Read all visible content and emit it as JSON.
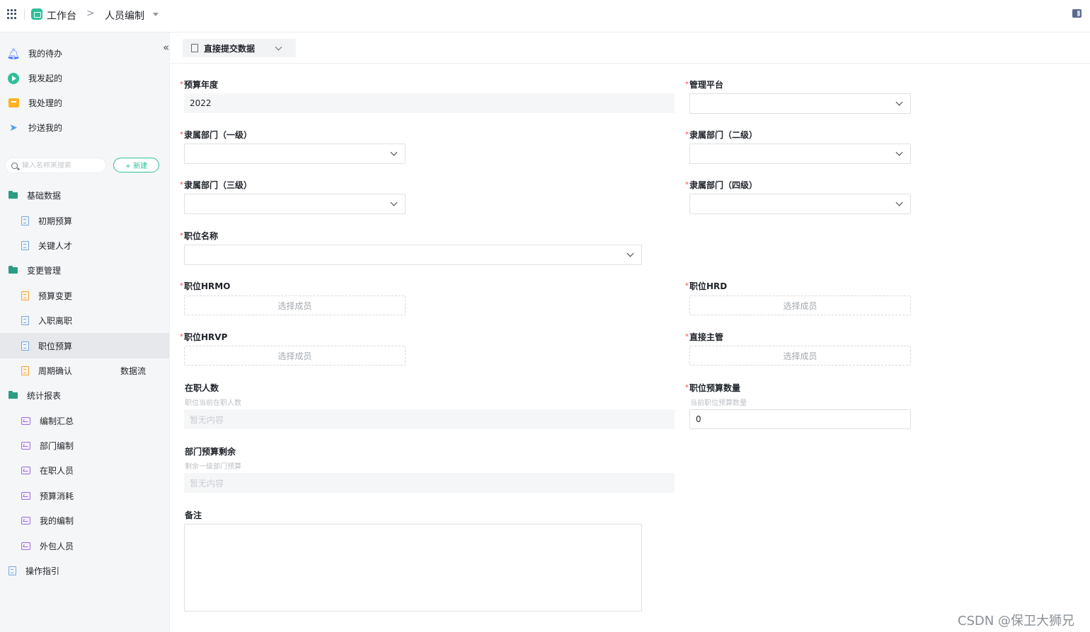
{
  "header": {
    "workspace": "工作台",
    "breadcrumb_sep": ">",
    "app_name": "人员编制"
  },
  "sidebar": {
    "quick": [
      {
        "label": "我的待办",
        "icon": "bell-icon"
      },
      {
        "label": "我发起的",
        "icon": "play-circle-icon"
      },
      {
        "label": "我处理的",
        "icon": "inbox-icon"
      },
      {
        "label": "抄送我的",
        "icon": "send-icon"
      }
    ],
    "search_placeholder": "输入名称来搜索",
    "new_label": "+ 新建",
    "tree": [
      {
        "type": "group",
        "label": "基础数据",
        "icon": "folder-icon"
      },
      {
        "type": "leaf",
        "label": "初期预算",
        "icon": "form-icon"
      },
      {
        "type": "leaf",
        "label": "关键人才",
        "icon": "form-icon"
      },
      {
        "type": "group",
        "label": "变更管理",
        "icon": "folder-icon"
      },
      {
        "type": "leaf",
        "label": "预算变更",
        "icon": "flow-form-icon"
      },
      {
        "type": "leaf",
        "label": "入职离职",
        "icon": "form-icon"
      },
      {
        "type": "leaf",
        "label": "职位预算",
        "icon": "form-icon",
        "active": true
      },
      {
        "type": "leaf",
        "label": "周期确认",
        "icon": "flow-form-icon",
        "extra": "数据流"
      },
      {
        "type": "group",
        "label": "统计报表",
        "icon": "folder-icon"
      },
      {
        "type": "leaf",
        "label": "编制汇总",
        "icon": "report-icon"
      },
      {
        "type": "leaf",
        "label": "部门编制",
        "icon": "report-icon"
      },
      {
        "type": "leaf",
        "label": "在职人员",
        "icon": "report-icon"
      },
      {
        "type": "leaf",
        "label": "预算消耗",
        "icon": "report-icon"
      },
      {
        "type": "leaf",
        "label": "我的编制",
        "icon": "report-icon"
      },
      {
        "type": "leaf",
        "label": "外包人员",
        "icon": "report-icon"
      },
      {
        "type": "rootleaf",
        "label": "操作指引",
        "icon": "form-icon"
      }
    ]
  },
  "toolbar": {
    "submit_label": "直接提交数据"
  },
  "form": {
    "required_mark": "*",
    "budget_year": {
      "label": "预算年度",
      "value": "2022"
    },
    "platform": {
      "label": "管理平台"
    },
    "dept1": {
      "label": "隶属部门（一级）"
    },
    "dept2": {
      "label": "隶属部门（二级）"
    },
    "dept3": {
      "label": "隶属部门（三级）"
    },
    "dept4": {
      "label": "隶属部门（四级）"
    },
    "position_name": {
      "label": "职位名称"
    },
    "hrmo": {
      "label": "职位HRMO",
      "placeholder": "选择成员"
    },
    "hrd": {
      "label": "职位HRD",
      "placeholder": "选择成员"
    },
    "hrvp": {
      "label": "职位HRVP",
      "placeholder": "选择成员"
    },
    "manager": {
      "label": "直接主管",
      "placeholder": "选择成员"
    },
    "headcount": {
      "label": "在职人数",
      "hint": "职位当前在职人数",
      "value": "暂无内容"
    },
    "budget_count": {
      "label": "职位预算数量",
      "hint": "当前职位预算数量",
      "value": "0"
    },
    "dept_remaining": {
      "label": "部门预算剩余",
      "hint": "剩余一级部门预算",
      "value": "暂无内容"
    },
    "remark": {
      "label": "备注"
    }
  },
  "watermark": "CSDN @保卫大狮兄",
  "colors": {
    "accent": "#2dbf9b",
    "required": "#f54a45",
    "primary_blue": "#3370ff"
  }
}
